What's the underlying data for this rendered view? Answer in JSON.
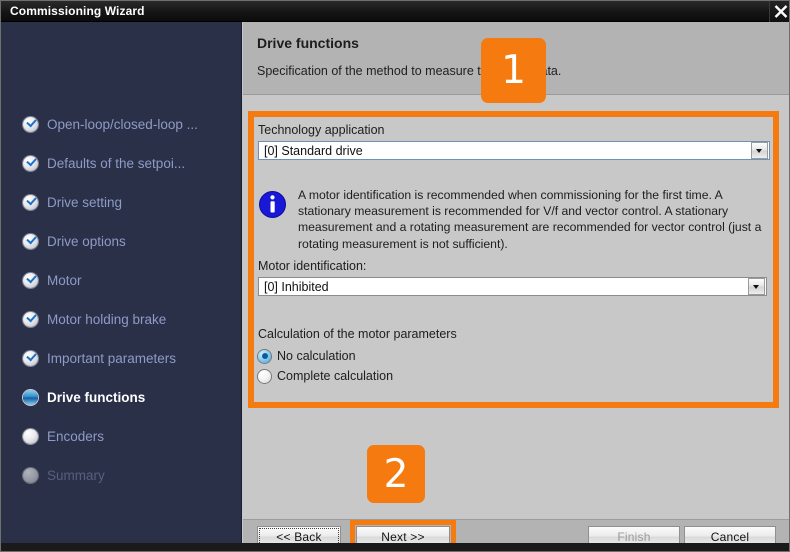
{
  "window": {
    "title": "Commissioning Wizard",
    "close_icon": "close-icon"
  },
  "colors": {
    "accent_orange": "#f57b10",
    "sidebar_bg": "#2b3049",
    "panel_bg": "#c8c8c8",
    "header_bg": "#b3b3b3",
    "info_blue": "#1515d8",
    "link_text": "#8e9bc4"
  },
  "sidebar": {
    "items": [
      {
        "label": "Open-loop/closed-loop ...",
        "state": "done"
      },
      {
        "label": "Defaults of the setpoi...",
        "state": "done"
      },
      {
        "label": "Drive setting",
        "state": "done"
      },
      {
        "label": "Drive options",
        "state": "done"
      },
      {
        "label": "Motor",
        "state": "done"
      },
      {
        "label": "Motor holding brake",
        "state": "done"
      },
      {
        "label": "Important parameters",
        "state": "done"
      },
      {
        "label": "Drive functions",
        "state": "current"
      },
      {
        "label": "Encoders",
        "state": "pending"
      },
      {
        "label": "Summary",
        "state": "disabled"
      }
    ]
  },
  "page": {
    "title": "Drive functions",
    "subtitle": "Specification of the method to measure the motor data."
  },
  "form": {
    "technology_application_label": "Technology application",
    "technology_application_value": "[0] Standard drive",
    "info_icon": "info-icon",
    "info_text": "A motor identification is recommended when commissioning for the first time. A stationary measurement is recommended for V/f and vector control. A stationary measurement and a rotating measurement are recommended for vector control (just a rotating measurement is not sufficient).",
    "motor_identification_label": "Motor identification:",
    "motor_identification_value": "[0] Inhibited",
    "calculation_label": "Calculation of the motor parameters",
    "radios": [
      {
        "label": "No calculation",
        "checked": true
      },
      {
        "label": "Complete calculation",
        "checked": false
      }
    ]
  },
  "footer": {
    "back_label": "<< Back",
    "next_label": "Next >>",
    "finish_label": "Finish",
    "cancel_label": "Cancel"
  },
  "callouts": [
    {
      "number": "1"
    },
    {
      "number": "2"
    }
  ]
}
